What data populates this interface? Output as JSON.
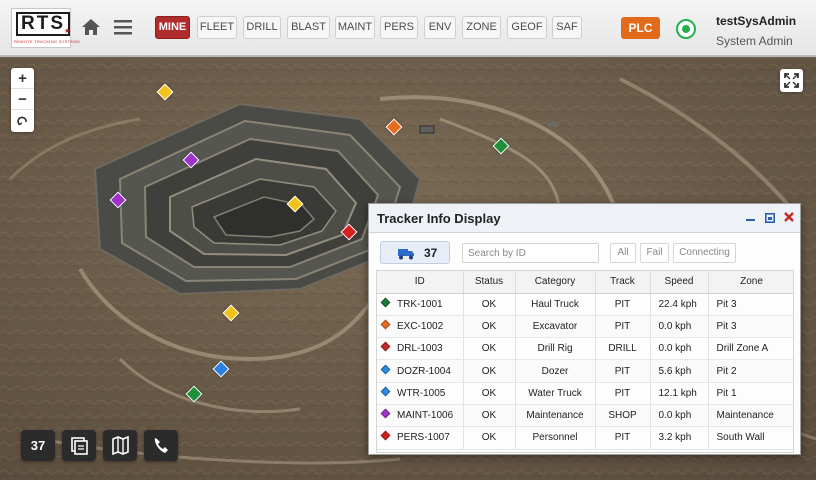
{
  "header": {
    "logo_text": "RTS",
    "logo_subtitle": "REMOTE TRACKING SYSTEMS",
    "nav": [
      {
        "label": "MINE",
        "active": true
      },
      {
        "label": "FLEET",
        "active": false
      },
      {
        "label": "DRILL",
        "active": false
      },
      {
        "label": "BLAST",
        "active": false
      },
      {
        "label": "MAINT",
        "active": false
      },
      {
        "label": "PERS",
        "active": false
      },
      {
        "label": "ENV",
        "active": false
      },
      {
        "label": "ZONE",
        "active": false
      },
      {
        "label": "GEOF",
        "active": false
      },
      {
        "label": "SAF",
        "active": false
      }
    ],
    "plc_label": "PLC",
    "connection_status_color": "#22b14c",
    "user_name": "testSysAdmin",
    "user_role": "System Admin"
  },
  "map": {
    "zoom_in_label": "+",
    "zoom_out_label": "−",
    "markers": [
      {
        "color": "#f2c21b"
      },
      {
        "color": "#e86c1e"
      },
      {
        "color": "#1f8f3a"
      },
      {
        "color": "#a033c7"
      },
      {
        "color": "#a033c7"
      },
      {
        "color": "#f2c21b"
      },
      {
        "color": "#d62020"
      },
      {
        "color": "#f2c21b"
      },
      {
        "color": "#2a7fe0"
      },
      {
        "color": "#1f8f3a"
      }
    ]
  },
  "bottom_bar": {
    "count_label": "37",
    "icons": [
      "layers-icon",
      "map-icon",
      "phone-icon"
    ]
  },
  "tracker_panel": {
    "title": "Tracker Info Display",
    "count": "37",
    "search_placeholder": "Search by ID",
    "filters": [
      {
        "label": "All",
        "active": true
      },
      {
        "label": "Fail",
        "active": false
      },
      {
        "label": "Connecting",
        "active": false
      }
    ],
    "columns": [
      "ID",
      "Status",
      "Category",
      "Track",
      "Speed",
      "Zone"
    ],
    "rows": [
      {
        "id": "TRK-1001",
        "color": "#1f7a3a",
        "status": "OK",
        "category": "Haul Truck",
        "track": "PIT",
        "speed": "22.4 kph",
        "zone": "Pit 3"
      },
      {
        "id": "EXC-1002",
        "color": "#e86c1e",
        "status": "OK",
        "category": "Excavator",
        "track": "PIT",
        "speed": "0.0 kph",
        "zone": "Pit 3"
      },
      {
        "id": "DRL-1003",
        "color": "#c62828",
        "status": "OK",
        "category": "Drill Rig",
        "track": "DRILL",
        "speed": "0.0 kph",
        "zone": "Drill Zone A"
      },
      {
        "id": "DOZR-1004",
        "color": "#2a8be0",
        "status": "OK",
        "category": "Dozer",
        "track": "PIT",
        "speed": "5.6 kph",
        "zone": "Pit 2"
      },
      {
        "id": "WTR-1005",
        "color": "#2a8be0",
        "status": "OK",
        "category": "Water Truck",
        "track": "PIT",
        "speed": "12.1 kph",
        "zone": "Pit 1"
      },
      {
        "id": "MAINT-1006",
        "color": "#a033c7",
        "status": "OK",
        "category": "Maintenance",
        "track": "SHOP",
        "speed": "0.0 kph",
        "zone": "Maintenance"
      },
      {
        "id": "PERS-1007",
        "color": "#d62020",
        "status": "OK",
        "category": "Personnel",
        "track": "PIT",
        "speed": "3.2 kph",
        "zone": "South Wall"
      }
    ]
  }
}
